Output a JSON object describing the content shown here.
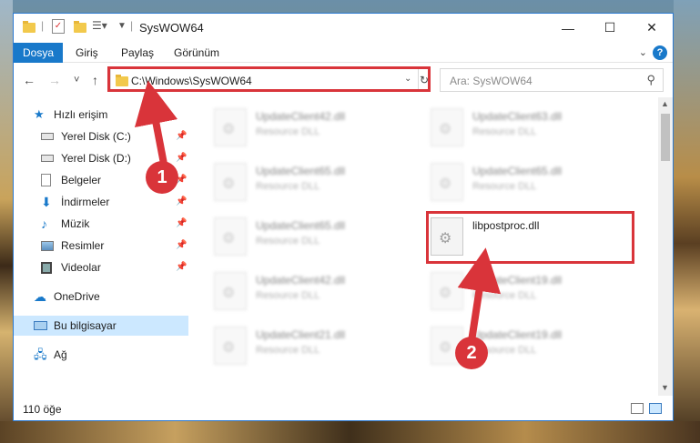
{
  "window": {
    "title": "SysWOW64",
    "minimize": "—",
    "maximize": "☐",
    "close": "✕"
  },
  "ribbon": {
    "tabs": [
      "Dosya",
      "Giriş",
      "Paylaş",
      "Görünüm"
    ],
    "help": "?"
  },
  "navbar": {
    "back": "←",
    "forward": "→",
    "recent": "˅",
    "up": "↑",
    "address": "C:\\Windows\\SysWOW64",
    "search_placeholder": "Ara: SysWOW64"
  },
  "sidebar": {
    "items": [
      {
        "label": "Hızlı erişim",
        "icon": "star-icon",
        "pinned": false
      },
      {
        "label": "Yerel Disk (C:)",
        "icon": "drive-icon",
        "pinned": true
      },
      {
        "label": "Yerel Disk (D:)",
        "icon": "drive-icon",
        "pinned": true
      },
      {
        "label": "Belgeler",
        "icon": "documents-icon",
        "pinned": true
      },
      {
        "label": "İndirmeler",
        "icon": "download-icon",
        "pinned": true
      },
      {
        "label": "Müzik",
        "icon": "music-icon",
        "pinned": true
      },
      {
        "label": "Resimler",
        "icon": "pictures-icon",
        "pinned": true
      },
      {
        "label": "Videolar",
        "icon": "videos-icon",
        "pinned": true
      },
      {
        "label": "OneDrive",
        "icon": "cloud-icon",
        "pinned": false
      },
      {
        "label": "Bu bilgisayar",
        "icon": "computer-icon",
        "pinned": false,
        "selected": true
      },
      {
        "label": "Ağ",
        "icon": "network-icon",
        "pinned": false
      }
    ]
  },
  "files": [
    {
      "name": "UpdateClient42.dll",
      "desc": "Resource DLL"
    },
    {
      "name": "UpdateClient63.dll",
      "desc": "Resource DLL"
    },
    {
      "name": "UpdateClient65.dll",
      "desc": "Resource DLL"
    },
    {
      "name": "UpdateClient65.dll",
      "desc": "Resource DLL"
    },
    {
      "name": "UpdateClient65.dll",
      "desc": "Resource DLL"
    },
    {
      "name": "libpostproc.dll",
      "desc": ""
    },
    {
      "name": "UpdateClient42.dll",
      "desc": "Resource DLL"
    },
    {
      "name": "UpdateClient19.dll",
      "desc": "Resource DLL"
    },
    {
      "name": "UpdateClient21.dll",
      "desc": "Resource DLL"
    },
    {
      "name": "UpdateClient19.dll",
      "desc": "Resource DLL"
    }
  ],
  "status": {
    "count": "110 öğe"
  },
  "annotations": {
    "step1": "1",
    "step2": "2",
    "color": "#d9343a"
  }
}
